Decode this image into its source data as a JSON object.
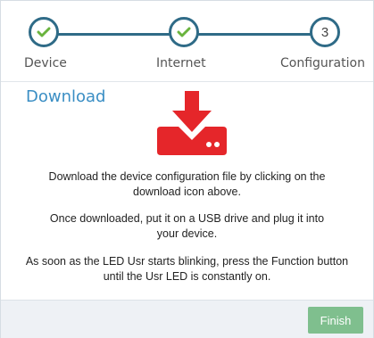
{
  "stepper": {
    "steps": [
      {
        "label": "Device",
        "state": "complete",
        "icon": "check-icon"
      },
      {
        "label": "Internet",
        "state": "complete",
        "icon": "check-icon"
      },
      {
        "label": "Configuration",
        "state": "current",
        "number": "3"
      }
    ]
  },
  "content": {
    "title": "Download",
    "icon": "download-icon",
    "paragraphs": [
      [
        "Download the device configuration file by clicking on the",
        "download icon above."
      ],
      [
        "Once downloaded, put it on a USB drive and plug it into",
        "your device."
      ],
      [
        "As soon as the LED Usr starts blinking, press the Function button",
        "until the Usr LED is constantly on."
      ]
    ]
  },
  "footer": {
    "finish_label": "Finish"
  },
  "colors": {
    "accent": "#2f6b87",
    "check": "#6ab43e",
    "download": "#e5262a",
    "title": "#3a8ec4",
    "finish": "#7fbf8e"
  }
}
